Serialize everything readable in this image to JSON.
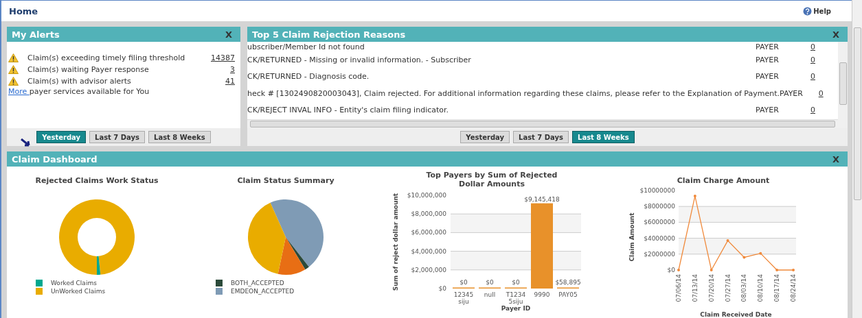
{
  "header": {
    "title": "Home",
    "help": "Help"
  },
  "alerts": {
    "title": "My Alerts",
    "close": "X",
    "items": [
      {
        "text": "Claim(s) exceeding timely filing threshold",
        "count": "14387"
      },
      {
        "text": "Claim(s) waiting Payer response",
        "count": "3"
      },
      {
        "text": "Claim(s) with advisor alerts",
        "count": "41"
      }
    ],
    "more_link": "More ",
    "more_text": "payer services available for You",
    "buttons": [
      {
        "label": "Yesterday",
        "selected": true
      },
      {
        "label": "Last 7 Days",
        "selected": false
      },
      {
        "label": "Last 8 Weeks",
        "selected": false
      }
    ]
  },
  "rejections": {
    "title": "Top 5 Claim Rejection Reasons",
    "close": "X",
    "rows": [
      {
        "reason": "ubscriber/Member Id not found",
        "source": "PAYER",
        "count": "0"
      },
      {
        "reason": "CK/RETURNED - Missing or invalid information. - Subscriber",
        "source": "PAYER",
        "count": "0"
      },
      {
        "reason": "CK/RETURNED - Diagnosis code.",
        "source": "PAYER",
        "count": "0"
      },
      {
        "reason": "heck # [1302490820003043], Claim rejected. For additional information regarding these claims, please refer to the Explanation of Payment.",
        "source": "PAYER",
        "count": "0"
      },
      {
        "reason": "CK/REJECT INVAL INFO - Entity's claim filing indicator.",
        "source": "PAYER",
        "count": "0"
      }
    ],
    "buttons": [
      {
        "label": "Yesterday",
        "selected": false
      },
      {
        "label": "Last 7 Days",
        "selected": false
      },
      {
        "label": "Last 8 Weeks",
        "selected": true
      }
    ]
  },
  "dashboard": {
    "title": "Claim Dashboard",
    "close": "X",
    "work_status": {
      "title": "Rejected Claims Work Status",
      "legend": [
        {
          "label": "Worked Claims",
          "color": "#00a88f"
        },
        {
          "label": "UnWorked Claims",
          "color": "#e9ac00"
        }
      ]
    },
    "status_summary": {
      "title": "Claim Status Summary",
      "legend": [
        {
          "label": "BOTH_ACCEPTED",
          "color": "#2c4a3a"
        },
        {
          "label": "EMDEON_ACCEPTED",
          "color": "#7f9bb5"
        }
      ]
    },
    "top_payers": {
      "chart_data": {
        "type": "bar",
        "title": "Top Payers by Sum of Rejected Dollar Amounts",
        "xlabel": "Payer ID",
        "ylabel": "Sum of reject dollar amount",
        "categories": [
          "12345siju",
          "null",
          "T12345siju",
          "9990",
          "PAY05"
        ],
        "series": [
          {
            "color": "#e8912a",
            "values": [
              0,
              0,
              0,
              9145418,
              58895
            ]
          }
        ],
        "grid": true,
        "value_labels": [
          "$0",
          "$0",
          "$0",
          "$9,145,418",
          "$58,895"
        ],
        "ylim": [
          0,
          10000000
        ],
        "yticks": [
          {
            "value": 0,
            "label": "$0"
          },
          {
            "value": 2000000,
            "label": "$2,000,000"
          },
          {
            "value": 4000000,
            "label": "$4,000,000"
          },
          {
            "value": 6000000,
            "label": "$6,000,000"
          },
          {
            "value": 8000000,
            "label": "$8,000,000"
          },
          {
            "value": 10000000,
            "label": "$10,000,000"
          }
        ]
      }
    },
    "charge_amount": {
      "chart_data": {
        "type": "line",
        "title": "Claim Charge Amount",
        "xlabel": "Claim Received Date",
        "ylabel": "Claim Amount",
        "categories": [
          "07/06/14",
          "07/13/14",
          "07/20/14",
          "07/27/14",
          "08/03/14",
          "08/10/14",
          "08/17/14",
          "08/24/14"
        ],
        "series": [
          {
            "color": "#f08a3c",
            "values": [
              0,
              9300000,
              0,
              3700000,
              1600000,
              2100000,
              0,
              0
            ]
          }
        ],
        "grid": true,
        "ylim": [
          0,
          10000000
        ],
        "yticks": [
          {
            "value": 0,
            "label": "$0"
          },
          {
            "value": 2000000,
            "label": "$2000000"
          },
          {
            "value": 4000000,
            "label": "$4000000"
          },
          {
            "value": 6000000,
            "label": "$6000000"
          },
          {
            "value": 8000000,
            "label": "$8000000"
          },
          {
            "value": 10000000,
            "label": "$10000000"
          }
        ]
      }
    }
  }
}
